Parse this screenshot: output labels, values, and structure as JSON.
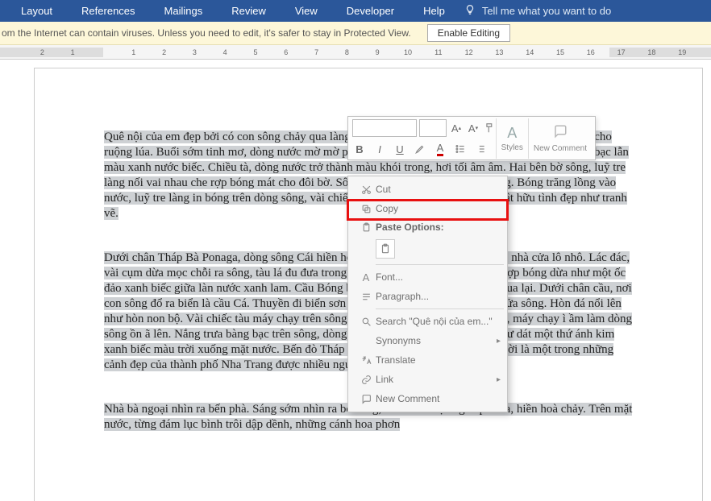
{
  "ribbon": {
    "tabs": [
      "Layout",
      "References",
      "Mailings",
      "Review",
      "View",
      "Developer",
      "Help"
    ],
    "tellme": "Tell me what you want to do"
  },
  "protected_view": {
    "message": "om the Internet can contain viruses. Unless you need to edit, it's safer to stay in Protected View.",
    "button": "Enable Editing"
  },
  "ruler": {
    "min": -2,
    "max": 19
  },
  "document": {
    "p1": "Quê nội của em đẹp bởi có con sông chảy qua làng. Con sông nhỏ quanh co chở nặng phù sa bồi đắp cho ruộng lúa. Buổi sớm tinh mơ, dòng nước mờ mờ phẳng lặng chảy. Giữa trưa, mặt sông nhấp nhô ánh bạc lẫn màu xanh nước biếc. Chiều tà, dòng nước trở thành màu khói trong, hơi tối âm âm. Hai bên bờ sông, luỹ tre làng nối vai nhau che rợp bóng mát cho đôi bờ. Sông đẹp nhất vào những đêm trăng. Bóng trăng lồng vào nước, luỹ tre làng in bóng trên dòng sông, vài chiếc thuyền neo trên bờ cát. Cảnh vật hữu tình đẹp như tranh vẽ.",
    "p2": "Dưới chân Tháp Bà Ponaga, dòng sông Cái hiền hoà chảy ra biển. Hai bên bờ sông, nhà cửa lô nhô. Lác đác, vài cụm dừa mọc chỗi ra sông, tàu lá đu đưa trong gió. Giữa sông, cù lao Hải Đảo rợp bóng dừa như một ốc đảo xanh biếc giữa làn nước xanh lam. Cầu Bóng bắc qua sông nườm nượp xe cộ qua lại. Dưới chân cầu, nơi con sông đổ ra biển là cầu Cá. Thuyền đi biển sơn hai màu xanh đỏ, đậu san sát ở cửa sông. Hòn đá nổi lên như hòn non bộ. Vài chiếc tàu máy chạy trên sông, bác tài công nhìn luồng lái chạy, máy chạy ì ầm làm dòng sông ồn ã lên. Nắng trưa bàng bạc trên sông, dòng sông lấp lánh, mặt nước sông như dát một thứ ánh kim xanh biếc màu trời xuống mặt nước. Bến đò Tháp Bà Trên bến thuyền gắn bó bao đời là một trong những cảnh đẹp của thành phố Nha Trang được nhiều người biết đến.",
    "p3": "Nhà bà ngoại nhìn ra bến phà. Sáng sớm nhìn ra bờ sông, con nước đục ngầu phù sa, hiền hoà chảy. Trên mặt nước, từng đám lục bình trôi dập dềnh, những cánh hoa phơn"
  },
  "mini_toolbar": {
    "styles": "Styles",
    "new_comment": "New Comment"
  },
  "context_menu": {
    "cut": "Cut",
    "copy": "Copy",
    "paste_header": "Paste Options:",
    "font": "Font...",
    "paragraph": "Paragraph...",
    "search": "Search \"Quê nội của em...\"",
    "synonyms": "Synonyms",
    "translate": "Translate",
    "link": "Link",
    "new_comment": "New Comment"
  }
}
